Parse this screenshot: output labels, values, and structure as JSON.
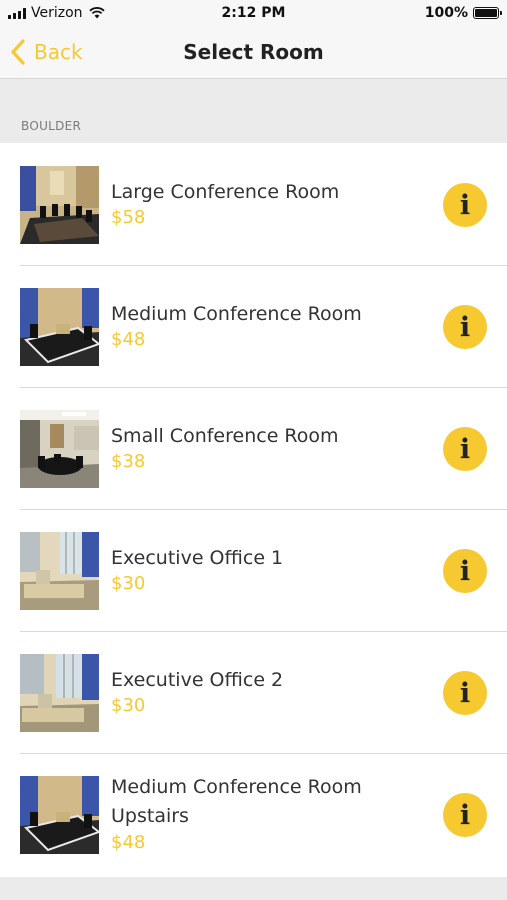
{
  "status_bar": {
    "carrier": "Verizon",
    "time": "2:12 PM",
    "battery": "100%"
  },
  "nav": {
    "back_label": "Back",
    "title": "Select Room"
  },
  "section": {
    "label": "BOULDER"
  },
  "rooms": [
    {
      "name": "Large Conference Room",
      "price": "$58"
    },
    {
      "name": "Medium Conference Room",
      "price": "$48"
    },
    {
      "name": "Small Conference Room",
      "price": "$38"
    },
    {
      "name": "Executive Office 1",
      "price": "$30"
    },
    {
      "name": "Executive Office 2",
      "price": "$30"
    },
    {
      "name": "Medium Conference Room Upstairs",
      "price": "$48"
    }
  ],
  "info_icon": "i",
  "colors": {
    "accent": "#f7c930",
    "background": "#ebebeb",
    "text": "#333333"
  }
}
